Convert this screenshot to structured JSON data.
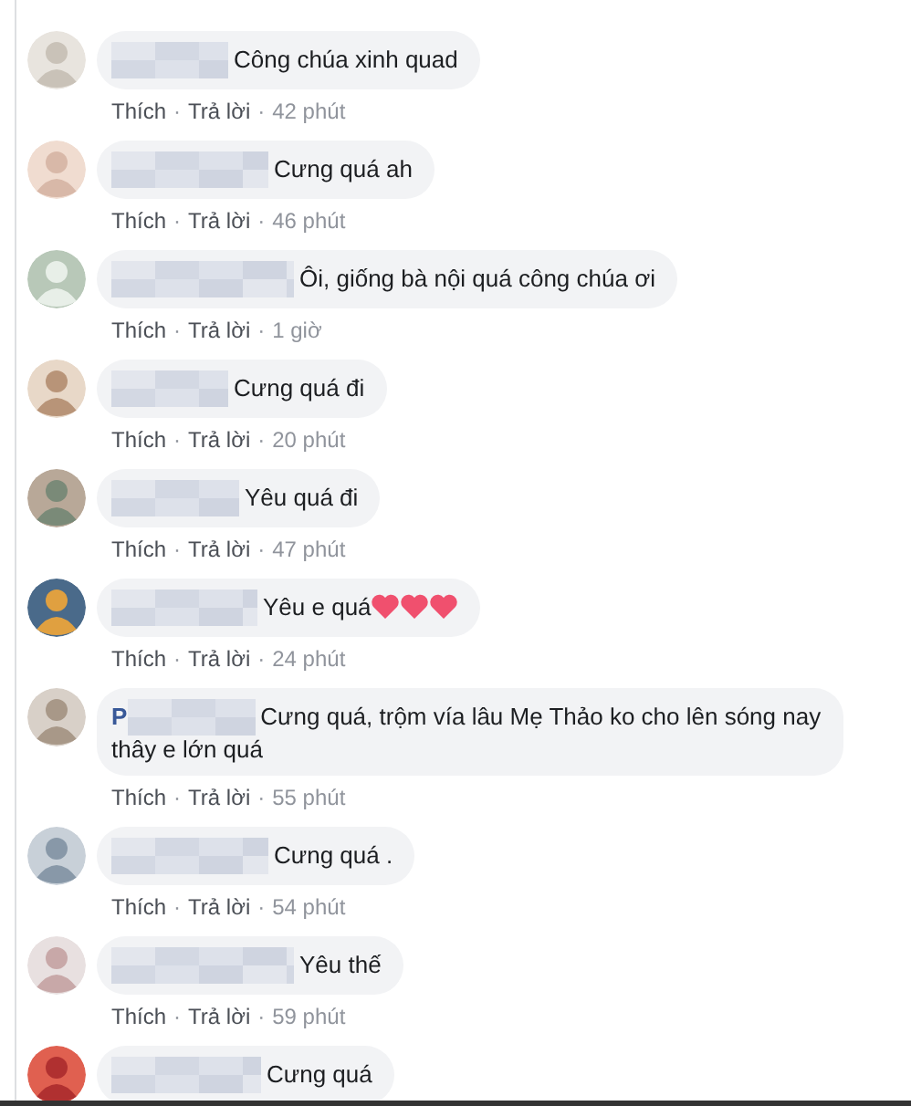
{
  "comments": [
    {
      "text": "Công chúa xinh quad",
      "like": "Thích",
      "dot_1": "·",
      "reply": "Trả lời",
      "dot_2": "·",
      "time": "42 phút"
    },
    {
      "text": "Cưng quá ah",
      "like": "Thích",
      "dot_1": "·",
      "reply": "Trả lời",
      "dot_2": "·",
      "time": "46 phút"
    },
    {
      "text": "Ôi, giống bà nội quá công chúa ơi",
      "like": "Thích",
      "dot_1": "·",
      "reply": "Trả lời",
      "dot_2": "·",
      "time": "1 giờ"
    },
    {
      "text": "Cưng quá đi",
      "like": "Thích",
      "dot_1": "·",
      "reply": "Trả lời",
      "dot_2": "·",
      "time": "20 phút"
    },
    {
      "text": "Yêu quá đi",
      "like": "Thích",
      "dot_1": "·",
      "reply": "Trả lời",
      "dot_2": "·",
      "time": "47 phút"
    },
    {
      "text": "Yêu e quá",
      "emoji": [
        {
          "kind": "heart"
        },
        {
          "kind": "heart"
        },
        {
          "kind": "heart"
        }
      ],
      "like": "Thích",
      "dot_1": "·",
      "reply": "Trả lời",
      "dot_2": "·",
      "time": "24 phút"
    },
    {
      "name_visible": "P",
      "text": "Cưng quá, trộm vía lâu Mẹ Thảo ko cho lên sóng nay",
      "text_line_2": "thây e lớn quá",
      "like": "Thích",
      "dot_1": "·",
      "reply": "Trả lời",
      "dot_2": "·",
      "time": "55 phút"
    },
    {
      "text": "Cưng quá .",
      "like": "Thích",
      "dot_1": "·",
      "reply": "Trả lời",
      "dot_2": "·",
      "time": "54 phút"
    },
    {
      "text": "Yêu thế",
      "like": "Thích",
      "dot_1": "·",
      "reply": "Trả lời",
      "dot_2": "·",
      "time": "59 phút"
    },
    {
      "text": "Cưng quá"
    }
  ]
}
